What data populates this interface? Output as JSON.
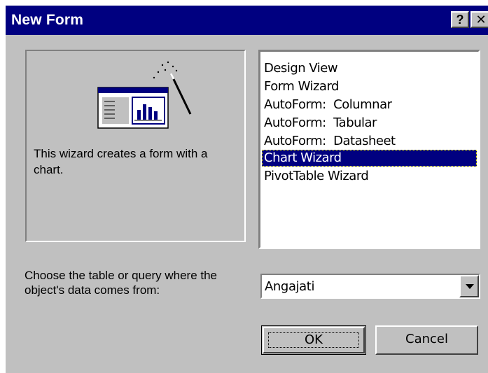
{
  "window": {
    "title": "New Form",
    "help_button": "?",
    "close_button": "✕"
  },
  "preview": {
    "description": "This wizard creates a form with a chart."
  },
  "options": {
    "items": [
      {
        "label": "Design View",
        "selected": false
      },
      {
        "label": "Form Wizard",
        "selected": false
      },
      {
        "label": "AutoForm:  Columnar",
        "selected": false
      },
      {
        "label": "AutoForm:  Tabular",
        "selected": false
      },
      {
        "label": "AutoForm:  Datasheet",
        "selected": false
      },
      {
        "label": "Chart Wizard",
        "selected": true
      },
      {
        "label": "PivotTable Wizard",
        "selected": false
      }
    ]
  },
  "source": {
    "prompt": "Choose the table or query where the object's data comes from:",
    "value": "Angajati"
  },
  "buttons": {
    "ok": "OK",
    "cancel": "Cancel"
  },
  "colors": {
    "titlebar": "#000080",
    "face": "#c0c0c0",
    "selection": "#000080"
  }
}
